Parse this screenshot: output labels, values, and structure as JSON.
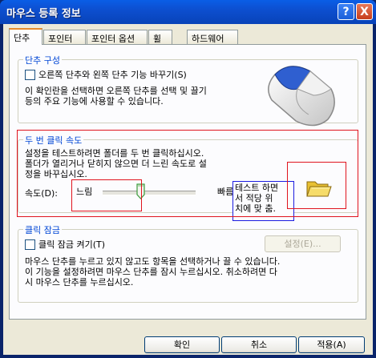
{
  "window": {
    "title": "마우스 등록 정보",
    "help_icon": "?",
    "close_icon": "X"
  },
  "tabs": [
    {
      "label": "단추",
      "active": true
    },
    {
      "label": "포인터",
      "active": false
    },
    {
      "label": "포인터 옵션",
      "active": false
    },
    {
      "label": "휠",
      "active": false
    },
    {
      "label": "하드웨어",
      "active": false
    }
  ],
  "button_config": {
    "title": "단추 구성",
    "swap_label": "오른쪽 단추와 왼쪽 단추 기능 바꾸기(S)",
    "swap_checked": false,
    "description": "이 확인란을 선택하면 오른쪽 단추를 선택 및 끌기\n등의 주요 기능에 사용할 수 있습니다.",
    "mouse_icon": "mouse-left-button-icon"
  },
  "double_click": {
    "title": "두 번 클릭 속도",
    "description": "설정을 테스트하려면 폴더를 두 번 클릭하십시오.\n폴더가 열리거나 닫히지 않으면 더 느린 속도로 설\n정을 바꾸십시오.",
    "speed_label": "속도(D):",
    "slow_label": "느림",
    "fast_label": "빠름",
    "slider_fraction": 0.4,
    "tooltip": "테스트 하면\n서 적당 위\n치에 맞 춤.",
    "folder_icon": "folder-icon"
  },
  "click_lock": {
    "title": "클릭 잠금",
    "enable_label": "클릭 잠금 켜기(T)",
    "enable_checked": false,
    "settings_button": "설정(E)...",
    "description": "마우스 단추를 누르고 있지 않고도 항목을 선택하거나 끌 수 있습니다.\n이 기능을 설정하려면 마우스 단추를 잠시 누르십시오. 취소하려면 다\n시 마우스 단추를 누르십시오."
  },
  "footer": {
    "ok": "확인",
    "cancel": "취소",
    "apply": "적용(A)"
  }
}
